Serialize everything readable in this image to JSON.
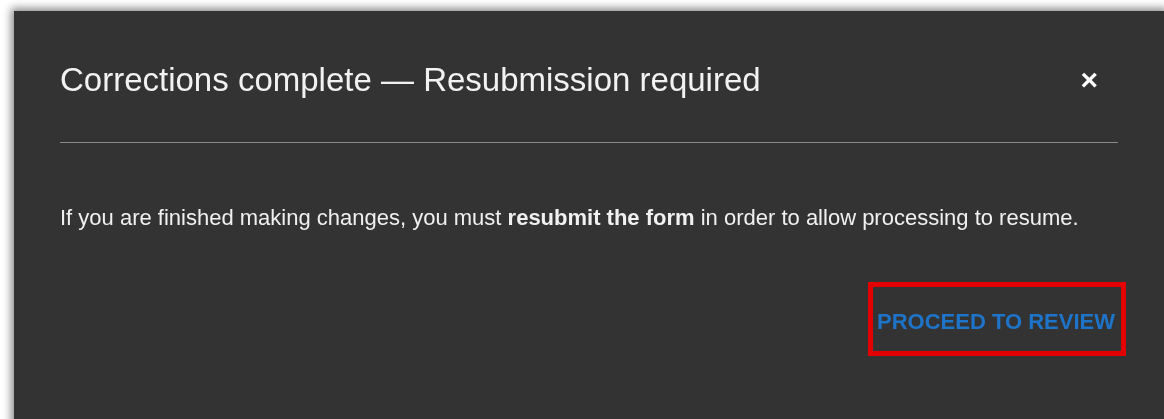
{
  "dialog": {
    "title": "Corrections complete — Resubmission required",
    "close": "×",
    "message": "If you are finished making changes, you must **resubmit the form** in order to allow processing to resume.",
    "action": {
      "label": "PROCEED TO REVIEW",
      "highlighted": true
    }
  }
}
